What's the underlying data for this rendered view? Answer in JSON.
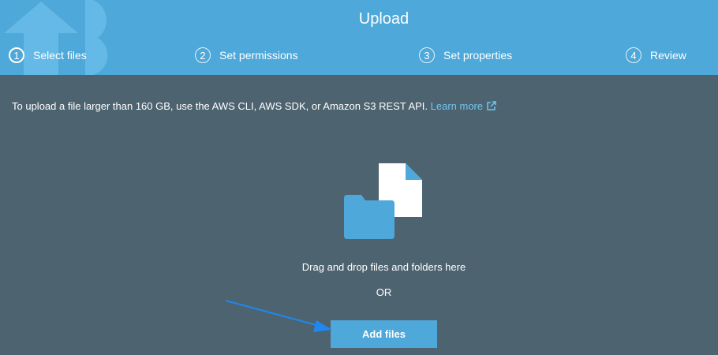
{
  "header": {
    "title": "Upload",
    "steps": [
      {
        "number": "1",
        "label": "Select files",
        "active": true
      },
      {
        "number": "2",
        "label": "Set permissions",
        "active": false
      },
      {
        "number": "3",
        "label": "Set properties",
        "active": false
      },
      {
        "number": "4",
        "label": "Review",
        "active": false
      }
    ]
  },
  "main": {
    "notice": "To upload a file larger than 160 GB, use the AWS CLI, AWS SDK, or Amazon S3 REST API.",
    "learn_more": "Learn more",
    "drop_text": "Drag and drop files and folders here",
    "or_text": "OR",
    "add_files_label": "Add files",
    "icons": [
      "folder-icon",
      "file-icon",
      "external-link-icon",
      "upload-arrow-icon"
    ]
  },
  "colors": {
    "header_bg": "#4ea8d9",
    "body_bg": "#4e6370",
    "link": "#6ec6f2",
    "button_bg": "#4ea8d9",
    "annotation_arrow": "#1e88f0"
  }
}
